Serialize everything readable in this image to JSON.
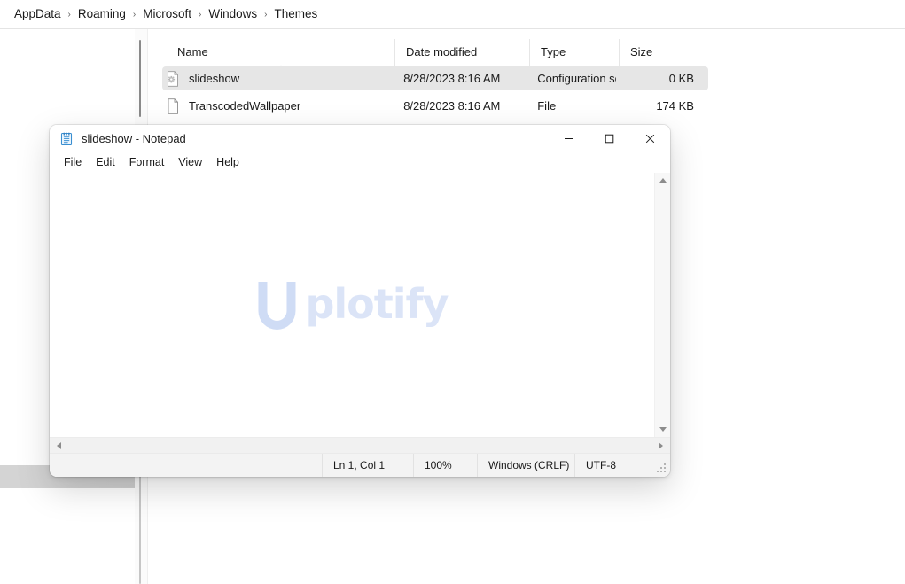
{
  "explorer": {
    "breadcrumb": {
      "name": "address-breadcrumb",
      "separator": "›",
      "items": [
        {
          "label": "AppData"
        },
        {
          "label": "Roaming"
        },
        {
          "label": "Microsoft"
        },
        {
          "label": "Windows"
        },
        {
          "label": "Themes"
        }
      ]
    },
    "columns": [
      {
        "key": "name",
        "label": "Name",
        "sorted": "asc",
        "sort_glyph": "⌃"
      },
      {
        "key": "date",
        "label": "Date modified"
      },
      {
        "key": "type",
        "label": "Type"
      },
      {
        "key": "size",
        "label": "Size"
      }
    ],
    "rows": [
      {
        "name": "slideshow",
        "date_modified": "8/28/2023 8:16 AM",
        "type": "Configuration sett...",
        "size": "0 KB",
        "icon": "configuration-settings-file-icon",
        "selected": true
      },
      {
        "name": "TranscodedWallpaper",
        "date_modified": "8/28/2023 8:16 AM",
        "type": "File",
        "size": "174 KB",
        "icon": "generic-file-icon",
        "selected": false
      }
    ]
  },
  "notepad": {
    "title": "slideshow - Notepad",
    "icon": "notepad-app-icon",
    "window_buttons": [
      {
        "name": "minimize-button",
        "glyph": "minimize-icon",
        "label": "Minimize"
      },
      {
        "name": "maximize-button",
        "glyph": "maximize-icon",
        "label": "Maximize"
      },
      {
        "name": "close-button",
        "glyph": "close-icon",
        "label": "Close"
      }
    ],
    "menu": [
      {
        "label": "File"
      },
      {
        "label": "Edit"
      },
      {
        "label": "Format"
      },
      {
        "label": "View"
      },
      {
        "label": "Help"
      }
    ],
    "document": {
      "text": "",
      "watermark": {
        "logo_letter": "U",
        "text": "plotify",
        "color": "#dbe4f7",
        "logo_color": "#cfdcf5"
      }
    },
    "scrollbars": {
      "vertical": {
        "up": "scroll-up-arrow",
        "down": "scroll-down-arrow"
      },
      "horizontal": {
        "left": "scroll-left-arrow",
        "right": "scroll-right-arrow"
      }
    },
    "status_bar": {
      "position": "Ln 1, Col 1",
      "zoom": "100%",
      "line_ending": "Windows (CRLF)",
      "encoding": "UTF-8"
    }
  },
  "colors": {
    "selection": "#e6e6e6",
    "window_bg": "#ffffff",
    "status_bg": "#f3f3f3",
    "text": "#1a1a1a"
  }
}
